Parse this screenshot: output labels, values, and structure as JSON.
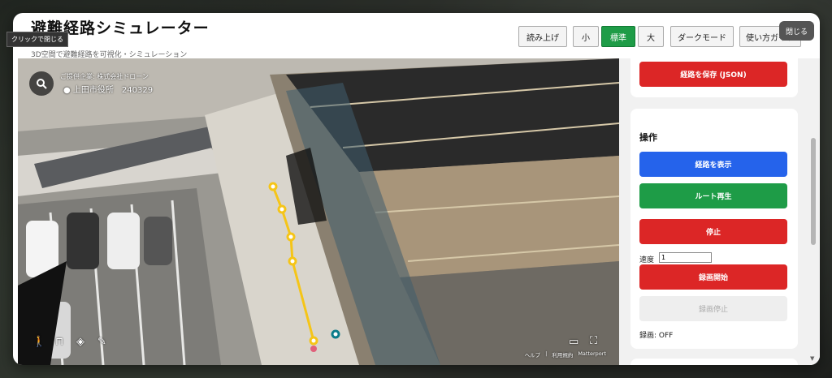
{
  "header": {
    "title": "避難経路シミュレーター",
    "subtitle": "3D空間で避難経路を可視化・シミュレーション",
    "read_aloud": "読み上げ",
    "size_small": "小",
    "size_standard": "標準",
    "size_large": "大",
    "dark_mode": "ダークモード",
    "guide": "使い方ガイド"
  },
  "tooltip": "クリックで閉じる",
  "close_label": "閉じる",
  "viewer": {
    "org": "ご提供企業: 株式会社ドローン",
    "place": "上田市役所　240329",
    "footer": [
      "ヘルプ",
      "|",
      "利用規約",
      "Matterport"
    ]
  },
  "panel": {
    "save_route": "経路を保存 (JSON)",
    "ops_title": "操作",
    "show_route": "経路を表示",
    "play_route": "ルート再生",
    "stop": "停止",
    "speed_label": "速度",
    "speed_value": "1",
    "rec_start": "録画開始",
    "rec_stop": "録画停止",
    "rec_status": "録画: OFF"
  },
  "colors": {
    "accent_green": "#1e9c47",
    "danger_red": "#dc2626",
    "primary_blue": "#2563eb",
    "route_yellow": "#f5c518"
  },
  "icons": [
    "search-icon",
    "pin-icon",
    "walk-icon",
    "floorplan-icon",
    "layers-icon",
    "measure-icon",
    "vr-icon",
    "fullscreen-icon"
  ]
}
